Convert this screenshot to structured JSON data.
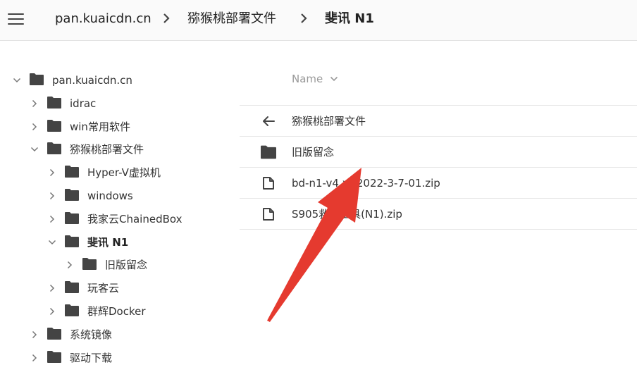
{
  "breadcrumb": [
    "pan.kuaicdn.cn",
    "猕猴桃部署文件",
    "斐讯 N1"
  ],
  "tree": [
    {
      "label": "pan.kuaicdn.cn",
      "level": 0,
      "expanded": true,
      "current": false
    },
    {
      "label": "idrac",
      "level": 1,
      "expanded": false,
      "current": false
    },
    {
      "label": "win常用软件",
      "level": 1,
      "expanded": false,
      "current": false
    },
    {
      "label": "猕猴桃部署文件",
      "level": 1,
      "expanded": true,
      "current": false
    },
    {
      "label": "Hyper-V虚拟机",
      "level": 2,
      "expanded": false,
      "current": false
    },
    {
      "label": "windows",
      "level": 2,
      "expanded": false,
      "current": false
    },
    {
      "label": "我家云ChainedBox",
      "level": 2,
      "expanded": false,
      "current": false
    },
    {
      "label": "斐讯 N1",
      "level": 2,
      "expanded": true,
      "current": true
    },
    {
      "label": "旧版留念",
      "level": 3,
      "expanded": false,
      "current": false
    },
    {
      "label": "玩客云",
      "level": 2,
      "expanded": false,
      "current": false
    },
    {
      "label": "群辉Docker",
      "level": 2,
      "expanded": false,
      "current": false
    },
    {
      "label": "系统镜像",
      "level": 1,
      "expanded": false,
      "current": false
    },
    {
      "label": "驱动下载",
      "level": 1,
      "expanded": false,
      "current": false
    }
  ],
  "list_header": {
    "name_label": "Name"
  },
  "list": [
    {
      "label": "猕猴桃部署文件",
      "icon": "back-arrow-icon"
    },
    {
      "label": "旧版留念",
      "icon": "folder-icon"
    },
    {
      "label": "bd-n1-v4.x-t2022-3-7-01.zip",
      "icon": "file-icon"
    },
    {
      "label": "S905救砖工具(N1).zip",
      "icon": "file-icon"
    }
  ],
  "colors": {
    "annotation_arrow": "#e53a2f",
    "icon": "#444444"
  }
}
